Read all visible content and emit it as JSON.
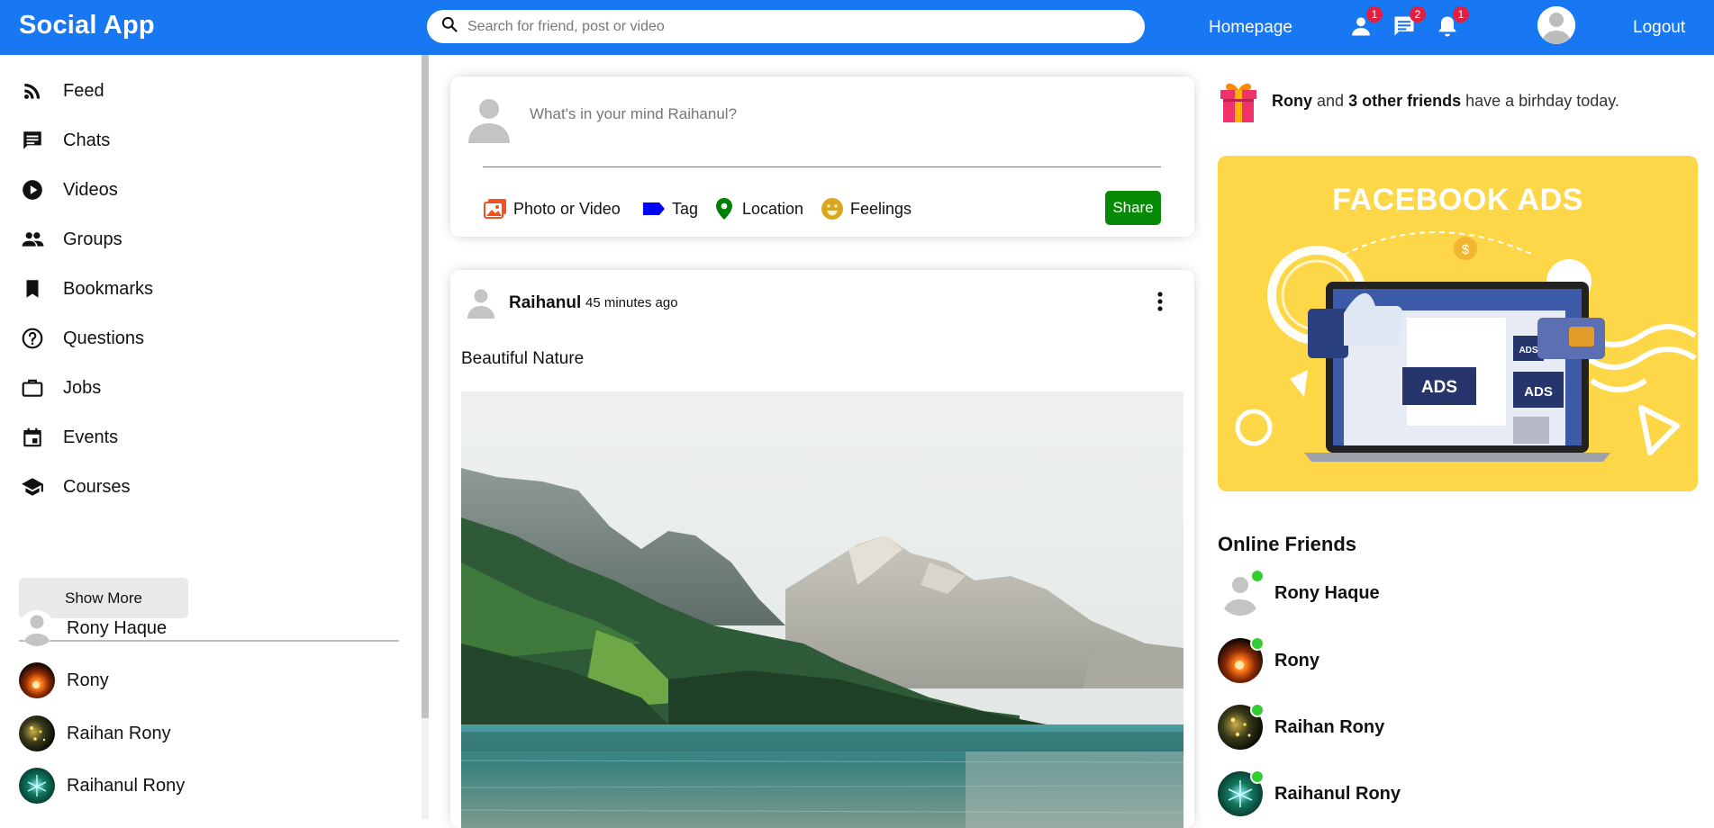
{
  "topbar": {
    "logo": "Social App",
    "search_placeholder": "Search for friend, post or video",
    "homepage": "Homepage",
    "logout": "Logout",
    "badges": {
      "friends": "1",
      "messages": "2",
      "notifications": "1"
    }
  },
  "sidebar": {
    "items": [
      {
        "label": "Feed",
        "icon": "rss-icon"
      },
      {
        "label": "Chats",
        "icon": "chat-icon"
      },
      {
        "label": "Videos",
        "icon": "play-circle-icon"
      },
      {
        "label": "Groups",
        "icon": "group-icon"
      },
      {
        "label": "Bookmarks",
        "icon": "bookmark-icon"
      },
      {
        "label": "Questions",
        "icon": "help-circle-icon"
      },
      {
        "label": "Jobs",
        "icon": "briefcase-icon"
      },
      {
        "label": "Events",
        "icon": "calendar-icon"
      },
      {
        "label": "Courses",
        "icon": "school-icon"
      }
    ],
    "show_more": "Show More",
    "friends": [
      {
        "name": "Rony Haque"
      },
      {
        "name": "Rony"
      },
      {
        "name": "Raihan Rony"
      },
      {
        "name": "Raihanul Rony"
      }
    ]
  },
  "share": {
    "placeholder": "What's in your mind Raihanul?",
    "options": [
      {
        "label": "Photo or Video",
        "color": "#f4511e"
      },
      {
        "label": "Tag",
        "color": "#0000ff"
      },
      {
        "label": "Location",
        "color": "#008000"
      },
      {
        "label": "Feelings",
        "color": "#daa520"
      }
    ],
    "button": "Share"
  },
  "post": {
    "user": "Raihanul",
    "time": "45 minutes ago",
    "text": "Beautiful Nature"
  },
  "rightbar": {
    "birthday": {
      "name": "Rony",
      "and": "and",
      "others": "3 other friends",
      "rest": "have a birhday today."
    },
    "ad_title": "FACEBOOK ADS",
    "ad_label_big": "ADS",
    "ad_label_side": "ADS",
    "ad_label_small": "ADS",
    "online_title": "Online Friends",
    "online": [
      {
        "name": "Rony Haque"
      },
      {
        "name": "Rony"
      },
      {
        "name": "Raihan Rony"
      },
      {
        "name": "Raihanul Rony"
      }
    ]
  },
  "colors": {
    "brand": "#1877f2",
    "online_dot": "#32cd32",
    "share_button": "#068a06",
    "badge": "#e41e3f",
    "ad_background": "#fdd748"
  }
}
